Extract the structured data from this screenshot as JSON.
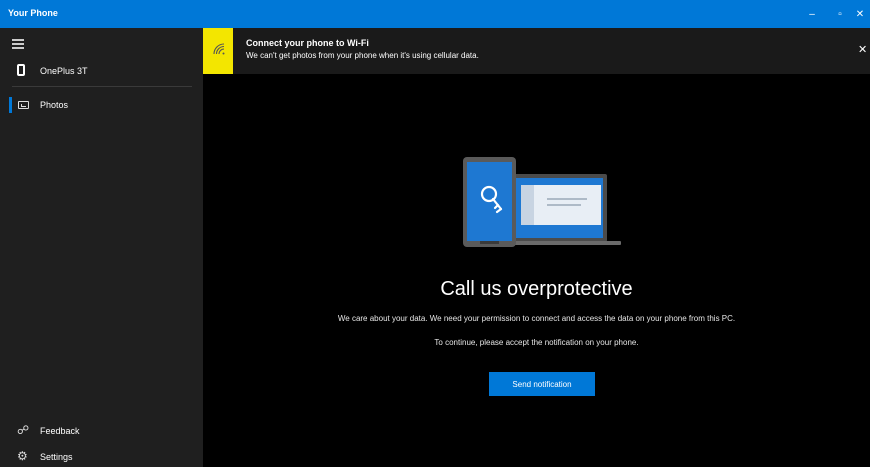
{
  "window": {
    "title": "Your Phone",
    "controls": {
      "minimize": "–",
      "maximize": "▫",
      "close": "✕"
    }
  },
  "sidebar": {
    "device": "OnePlus 3T",
    "nav_items": [
      {
        "label": "Photos",
        "icon": "photos-icon",
        "selected": true
      }
    ],
    "footer_items": [
      {
        "label": "Feedback",
        "icon": "feedback-icon"
      },
      {
        "label": "Settings",
        "icon": "gear-icon"
      }
    ]
  },
  "banner": {
    "title": "Connect your phone to Wi-Fi",
    "text": "We can't get photos from your phone when it's using cellular data.",
    "icon": "wifi-icon",
    "accent_color": "#f3e600"
  },
  "main": {
    "headline": "Call us overprotective",
    "description": "We care about your data. We need your permission to connect and access the data on your phone from this PC.",
    "instruction": "To continue, please accept the notification on your phone.",
    "send_button": "Send notification"
  },
  "colors": {
    "accent": "#0078d7",
    "sidebar_bg": "#1f1f1f",
    "main_bg": "#000000"
  }
}
